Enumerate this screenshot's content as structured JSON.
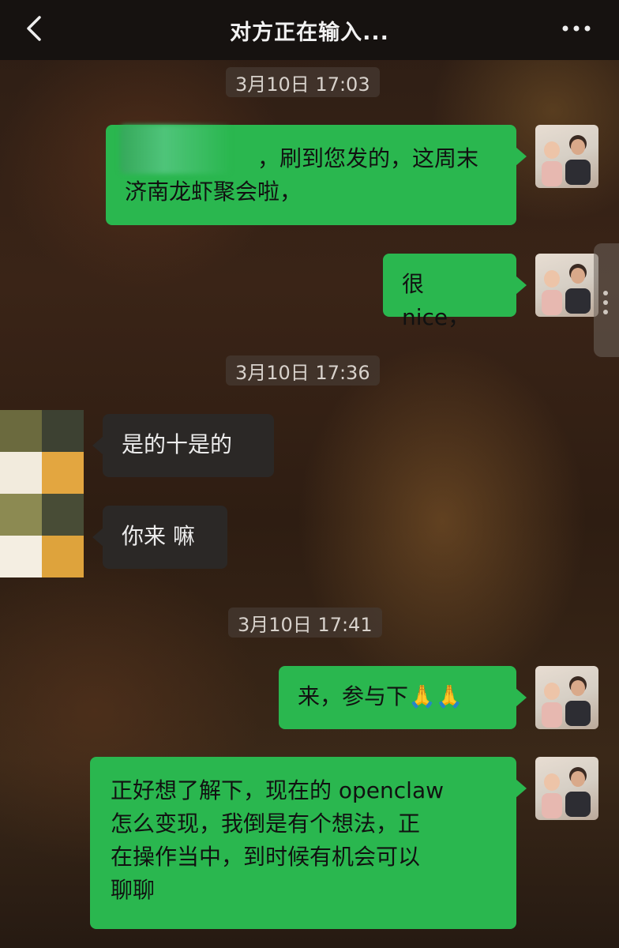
{
  "header": {
    "title": "对方正在输入..."
  },
  "messages": [
    {
      "type": "timestamp",
      "text": "3月10日 17:03"
    },
    {
      "type": "sent",
      "text_line1": "，刷到您发的，这周末",
      "text_line2": "济南龙虾聚会啦，"
    },
    {
      "type": "sent",
      "text": "很 nice，"
    },
    {
      "type": "timestamp",
      "text": "3月10日 17:36"
    },
    {
      "type": "received",
      "text": "是的十是的"
    },
    {
      "type": "received",
      "text": "你来 嘛"
    },
    {
      "type": "timestamp",
      "text": "3月10日 17:41"
    },
    {
      "type": "sent",
      "text": "来，参与下🙏🙏"
    },
    {
      "type": "sent",
      "lines": [
        "正好想了解下，现在的 openclaw",
        "怎么变现，我倒是有个想法，正",
        "在操作当中，到时候有机会可以",
        "聊聊"
      ]
    }
  ],
  "colors": {
    "sent_bubble": "#2ab74f",
    "received_bubble": "#2b2826",
    "topbar": "#161210"
  },
  "icons": {
    "back": "chevron-left-icon",
    "more": "ellipsis-icon"
  }
}
